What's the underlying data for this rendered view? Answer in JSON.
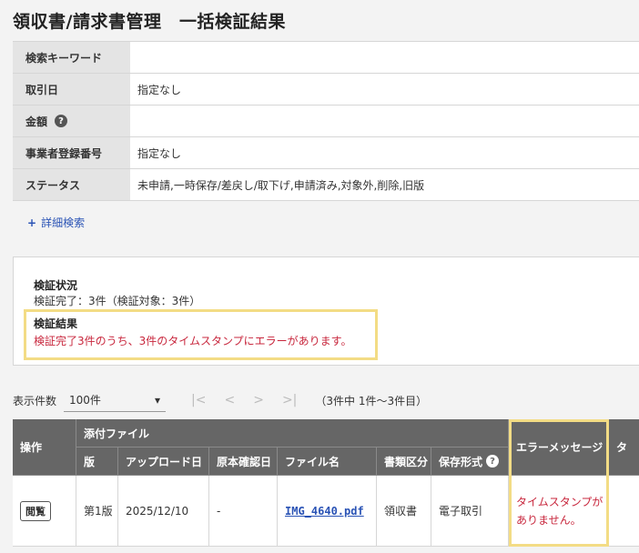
{
  "page": {
    "title": "領収書/請求書管理　一括検証結果"
  },
  "search": {
    "rows": [
      {
        "label": "検索キーワード",
        "value": ""
      },
      {
        "label": "取引日",
        "value": "指定なし"
      },
      {
        "label": "金額",
        "value": ""
      },
      {
        "label": "事業者登録番号",
        "value": "指定なし"
      },
      {
        "label": "ステータス",
        "value": "未申請,一時保存/差戻し/取下げ,申請済み,対象外,削除,旧版"
      }
    ],
    "help_icon": "?",
    "detail_search_plus": "+",
    "detail_search_label": "詳細検索"
  },
  "verification": {
    "status_heading": "検証状況",
    "status_text": "検証完了：3件（検証対象：3件）",
    "result_heading": "検証結果",
    "result_text": "検証完了3件のうち、3件のタイムスタンプにエラーがあります。"
  },
  "pager": {
    "label": "表示件数",
    "per_page": "100件",
    "first": "|<",
    "prev": "<",
    "next": ">",
    "last": ">|",
    "info": "（3件中 1件～3件目）"
  },
  "table": {
    "headers": {
      "action": "操作",
      "attachment": "添付ファイル",
      "version": "版",
      "upload_date": "アップロード日",
      "original_confirm_date": "原本確認日",
      "file_name": "ファイル名",
      "doc_type": "書類区分",
      "storage_format": "保存形式",
      "error_message": "エラーメッセージ",
      "next_col_partial": "タ"
    },
    "rows": [
      {
        "action_label": "閲覧",
        "version": "第1版",
        "upload_date": "2025/12/10",
        "original_confirm_date": "-",
        "file_name": "IMG_4640.pdf",
        "doc_type": "領収書",
        "storage_format": "電子取引",
        "error_message": "タイムスタンプがありません。"
      }
    ]
  },
  "colors": {
    "link": "#2a53b5",
    "error": "#c8273d",
    "highlight": "#f3dc85",
    "header_bg": "#666666"
  }
}
